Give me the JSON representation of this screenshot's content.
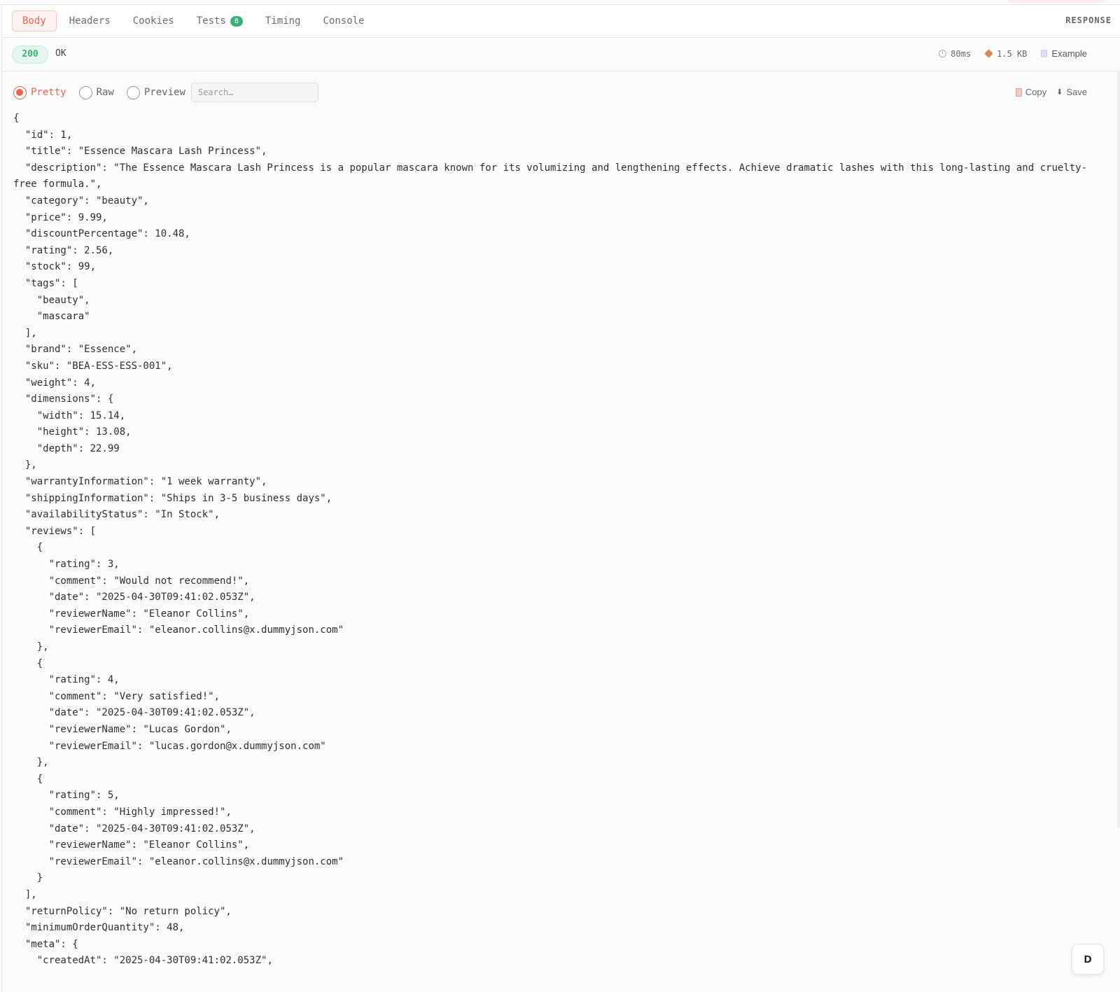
{
  "tabs": [
    {
      "label": "Body",
      "active": true
    },
    {
      "label": "Headers"
    },
    {
      "label": "Cookies"
    },
    {
      "label": "Tests",
      "badge": "8"
    },
    {
      "label": "Timing"
    },
    {
      "label": "Console"
    }
  ],
  "panel_label": "RESPONSE",
  "status": {
    "code": "200",
    "text": "OK",
    "time": "80ms",
    "size": "1.5 KB",
    "example": "Example"
  },
  "view_modes": {
    "pretty": "Pretty",
    "raw": "Raw",
    "preview": "Preview",
    "selected": "Pretty"
  },
  "search": {
    "placeholder": "Search…",
    "value": ""
  },
  "actions": {
    "copy": "Copy",
    "save": "Save"
  },
  "avatar": {
    "initial": "D"
  },
  "colors": {
    "accent": "#e8674a",
    "success": "#3fae76",
    "border": "#e6e6e6",
    "background": "#fafbfc"
  },
  "icons": {
    "time": "clock-icon",
    "size": "package-icon",
    "example": "document-icon",
    "copy": "clipboard-icon",
    "save": "download-icon"
  },
  "response_body": "{\n  \"id\": 1,\n  \"title\": \"Essence Mascara Lash Princess\",\n  \"description\": \"The Essence Mascara Lash Princess is a popular mascara known for its volumizing and lengthening effects. Achieve dramatic lashes with this long-lasting and cruelty-free formula.\",\n  \"category\": \"beauty\",\n  \"price\": 9.99,\n  \"discountPercentage\": 10.48,\n  \"rating\": 2.56,\n  \"stock\": 99,\n  \"tags\": [\n    \"beauty\",\n    \"mascara\"\n  ],\n  \"brand\": \"Essence\",\n  \"sku\": \"BEA-ESS-ESS-001\",\n  \"weight\": 4,\n  \"dimensions\": {\n    \"width\": 15.14,\n    \"height\": 13.08,\n    \"depth\": 22.99\n  },\n  \"warrantyInformation\": \"1 week warranty\",\n  \"shippingInformation\": \"Ships in 3-5 business days\",\n  \"availabilityStatus\": \"In Stock\",\n  \"reviews\": [\n    {\n      \"rating\": 3,\n      \"comment\": \"Would not recommend!\",\n      \"date\": \"2025-04-30T09:41:02.053Z\",\n      \"reviewerName\": \"Eleanor Collins\",\n      \"reviewerEmail\": \"eleanor.collins@x.dummyjson.com\"\n    },\n    {\n      \"rating\": 4,\n      \"comment\": \"Very satisfied!\",\n      \"date\": \"2025-04-30T09:41:02.053Z\",\n      \"reviewerName\": \"Lucas Gordon\",\n      \"reviewerEmail\": \"lucas.gordon@x.dummyjson.com\"\n    },\n    {\n      \"rating\": 5,\n      \"comment\": \"Highly impressed!\",\n      \"date\": \"2025-04-30T09:41:02.053Z\",\n      \"reviewerName\": \"Eleanor Collins\",\n      \"reviewerEmail\": \"eleanor.collins@x.dummyjson.com\"\n    }\n  ],\n  \"returnPolicy\": \"No return policy\",\n  \"minimumOrderQuantity\": 48,\n  \"meta\": {\n    \"createdAt\": \"2025-04-30T09:41:02.053Z\","
}
